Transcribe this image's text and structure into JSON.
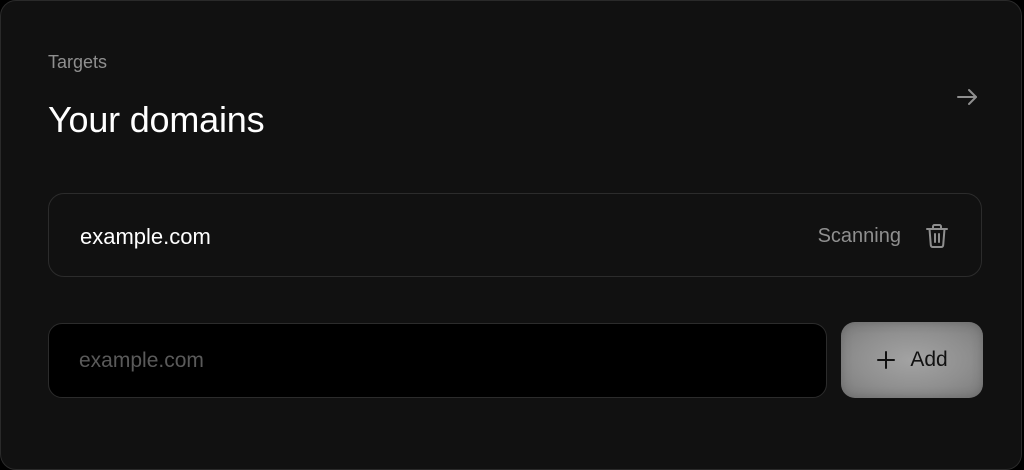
{
  "header": {
    "eyebrow": "Targets",
    "title": "Your domains",
    "nav_icon": "arrow-right-icon"
  },
  "domains": [
    {
      "name": "example.com",
      "status": "Scanning",
      "action_icon": "trash-icon"
    }
  ],
  "add_form": {
    "placeholder": "example.com",
    "value": "",
    "button_label": "Add",
    "button_icon": "plus-icon"
  }
}
